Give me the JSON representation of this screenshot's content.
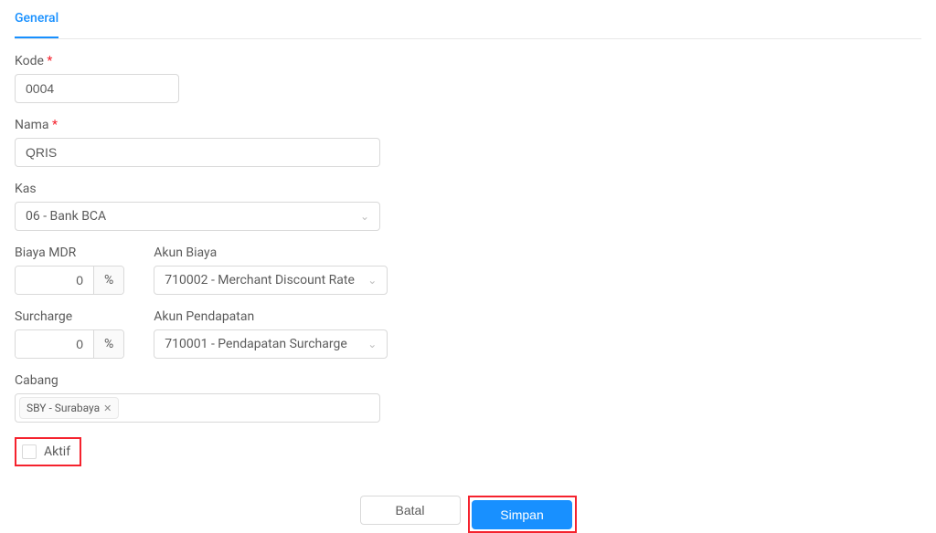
{
  "tabs": {
    "general": "General"
  },
  "labels": {
    "kode": "Kode",
    "nama": "Nama",
    "kas": "Kas",
    "biaya_mdr": "Biaya MDR",
    "akun_biaya": "Akun Biaya",
    "surcharge": "Surcharge",
    "akun_pendapatan": "Akun Pendapatan",
    "cabang": "Cabang",
    "aktif": "Aktif"
  },
  "values": {
    "kode": "0004",
    "nama": "QRIS",
    "kas": "06 - Bank BCA",
    "biaya_mdr": "0",
    "akun_biaya": "710002 - Merchant Discount Rate",
    "surcharge": "0",
    "akun_pendapatan": "710001 - Pendapatan Surcharge",
    "cabang_tag": "SBY - Surabaya"
  },
  "symbols": {
    "percent": "%",
    "close_x": "✕",
    "chevron_down": "⌄"
  },
  "buttons": {
    "cancel": "Batal",
    "save": "Simpan"
  }
}
